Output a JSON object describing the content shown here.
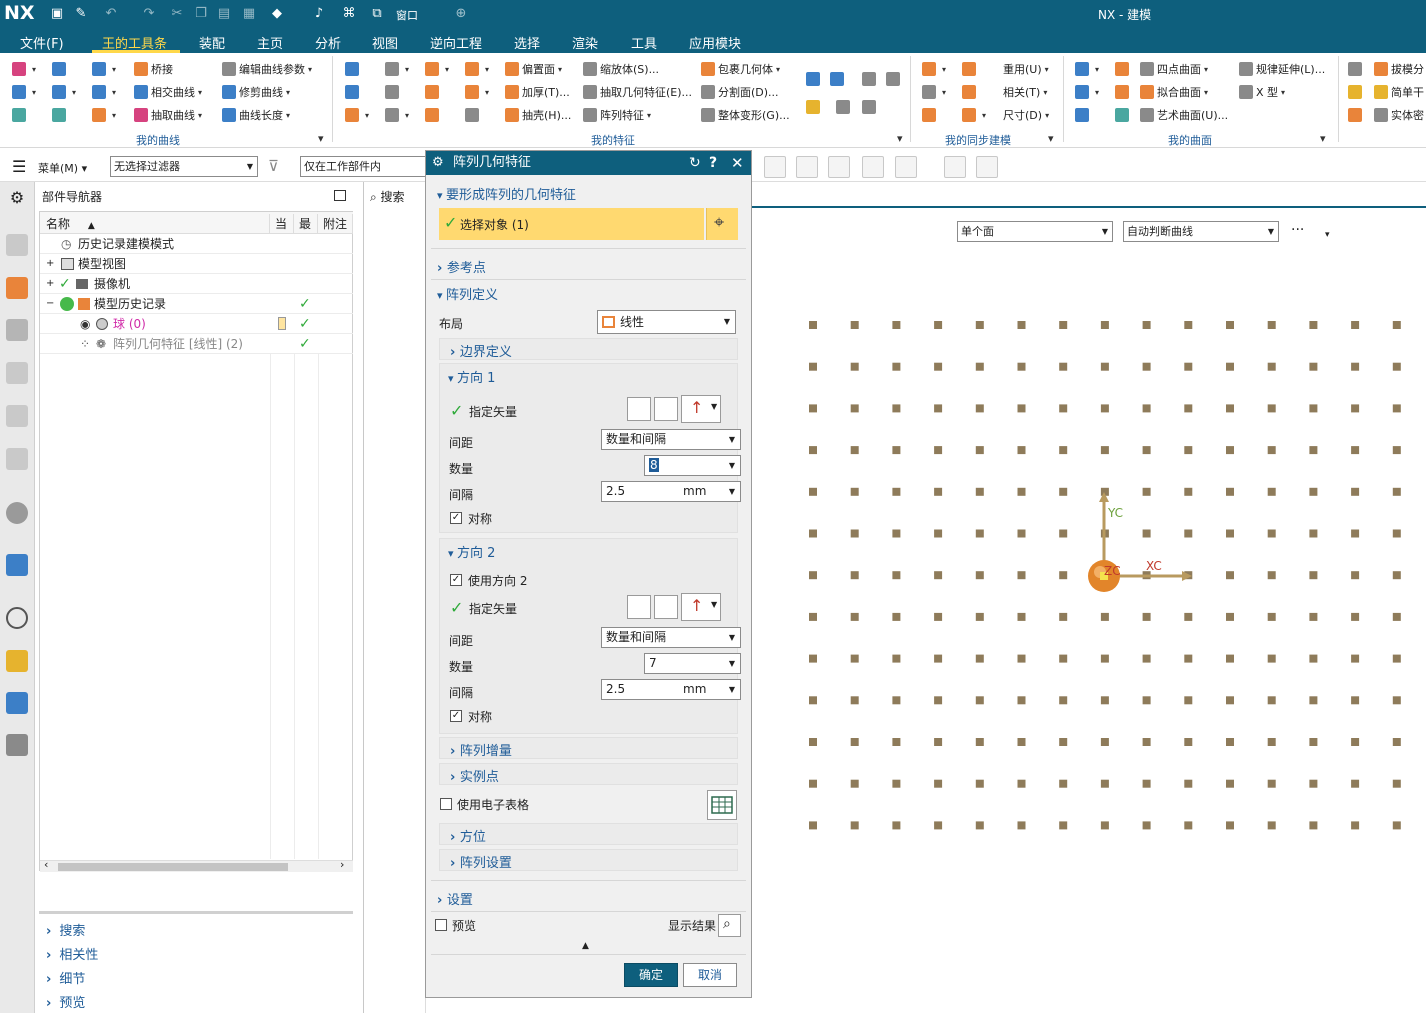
{
  "app": {
    "logo": "NX",
    "window_title": "NX - 建模",
    "window_menu": "窗口"
  },
  "menubar": [
    "文件(F)",
    "王的工具条",
    "装配",
    "主页",
    "分析",
    "视图",
    "逆向工程",
    "选择",
    "渲染",
    "工具",
    "应用模块"
  ],
  "ribbon": {
    "curves": {
      "group": "我的曲线",
      "items": [
        "桥接",
        "编辑曲线参数",
        "相交曲线",
        "修剪曲线",
        "抽取曲线",
        "曲线长度"
      ]
    },
    "features": {
      "group": "我的特征",
      "items": [
        "偏置面",
        "缩放体(S)...",
        "包裹几何体",
        "加厚(T)...",
        "抽取几何特征(E)...",
        "分割面(D)...",
        "抽壳(H)...",
        "阵列特征",
        "整体变形(G)..."
      ]
    },
    "sync": {
      "group": "我的同步建模",
      "items": [
        "重用(U)",
        "相关(T)",
        "尺寸(D)"
      ]
    },
    "surfaces": {
      "group": "我的曲面",
      "items": [
        "四点曲面",
        "规律延伸(L)...",
        "拟合曲面",
        "X 型",
        "艺术曲面(U)..."
      ]
    },
    "extra": {
      "items": [
        "拔模分",
        "简单干",
        "实体密"
      ]
    }
  },
  "selection_bar": {
    "menu": "菜单(M)",
    "filter": "无选择过滤器",
    "scope": "仅在工作部件内"
  },
  "navigator": {
    "title": "部件导航器",
    "search_tab": "搜索",
    "columns": [
      "名称",
      "当",
      "最",
      "附注"
    ],
    "rows": [
      {
        "label": "历史记录建模模式",
        "check": ""
      },
      {
        "label": "模型视图",
        "check": ""
      },
      {
        "label": "摄像机",
        "check": ""
      },
      {
        "label": "模型历史记录",
        "check": "✓"
      },
      {
        "label": "球 (0)",
        "check": "✓"
      },
      {
        "label": "阵列几何特征 [线性] (2)",
        "check": "✓"
      }
    ],
    "sections": [
      "搜索",
      "相关性",
      "细节",
      "预览"
    ]
  },
  "dialog": {
    "title": "阵列几何特征",
    "sec_geometry": "要形成阵列的几何特征",
    "select_object": "选择对象 (1)",
    "sec_refpoint": "参考点",
    "sec_pattern_def": "阵列定义",
    "layout_label": "布局",
    "layout_value": "线性",
    "boundary": "边界定义",
    "dir1": {
      "title": "方向 1",
      "vector": "指定矢量",
      "spacing_label": "间距",
      "spacing_value": "数量和间隔",
      "count_label": "数量",
      "count_value": "8",
      "pitch_label": "间隔",
      "pitch_value": "2.5",
      "pitch_unit": "mm",
      "symmetric": "对称"
    },
    "dir2": {
      "title": "方向 2",
      "use": "使用方向 2",
      "vector": "指定矢量",
      "spacing_label": "间距",
      "spacing_value": "数量和间隔",
      "count_label": "数量",
      "count_value": "7",
      "pitch_label": "间隔",
      "pitch_value": "2.5",
      "pitch_unit": "mm",
      "symmetric": "对称"
    },
    "increment": "阵列增量",
    "instance_points": "实例点",
    "spreadsheet": "使用电子表格",
    "orientation": "方位",
    "pattern_settings": "阵列设置",
    "settings": "设置",
    "preview": "预览",
    "show_result": "显示结果",
    "ok": "确定",
    "cancel": "取消"
  },
  "graphics": {
    "face_rule": "单个面",
    "curve_rule": "自动判断曲线",
    "more": "···",
    "axis_y": "YC",
    "axis_x": "XC",
    "axis_z": "ZC"
  },
  "colors": {
    "titlebar": "#0e5f7d",
    "active_tab": "#ffd84a",
    "selected_row": "#ffd970",
    "dot": "#8e7b5a",
    "check": "#2faa3a",
    "ok_button": "#0e5f7d"
  }
}
